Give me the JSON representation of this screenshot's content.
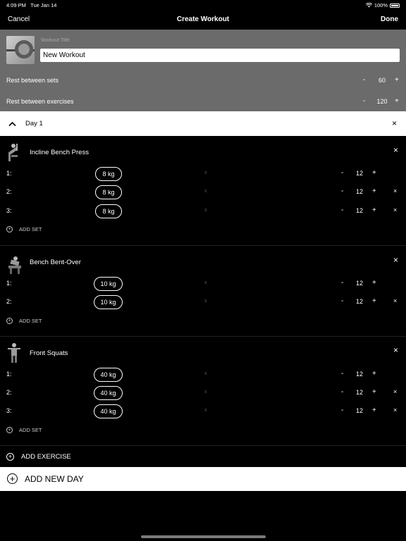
{
  "status": {
    "time": "4:09 PM",
    "date": "Tue Jan 14",
    "battery": "100%"
  },
  "nav": {
    "cancel": "Cancel",
    "title": "Create Workout",
    "done": "Done"
  },
  "header": {
    "title_label": "Workout Title",
    "title_value": "New Workout",
    "rest_sets": {
      "label": "Rest between sets",
      "minus": "-",
      "value": "60",
      "plus": "+"
    },
    "rest_exercises": {
      "label": "Rest between exercises",
      "minus": "-",
      "value": "120",
      "plus": "+"
    }
  },
  "day": {
    "chevron": "^",
    "label": "Day 1",
    "close": "×"
  },
  "exercises": [
    {
      "name": "Incline Bench Press",
      "close": "×",
      "add_set": "ADD SET",
      "sets": [
        {
          "index": "1:",
          "weight": "8 kg",
          "mult": "x",
          "minus": "-",
          "reps": "12",
          "plus": "+",
          "delete": ""
        },
        {
          "index": "2:",
          "weight": "8 kg",
          "mult": "x",
          "minus": "-",
          "reps": "12",
          "plus": "+",
          "delete": "×"
        },
        {
          "index": "3:",
          "weight": "8 kg",
          "mult": "x",
          "minus": "-",
          "reps": "12",
          "plus": "+",
          "delete": "×"
        }
      ]
    },
    {
      "name": "Bench Bent-Over",
      "close": "×",
      "add_set": "ADD SET",
      "sets": [
        {
          "index": "1:",
          "weight": "10 kg",
          "mult": "x",
          "minus": "-",
          "reps": "12",
          "plus": "+",
          "delete": ""
        },
        {
          "index": "2:",
          "weight": "10 kg",
          "mult": "x",
          "minus": "-",
          "reps": "12",
          "plus": "+",
          "delete": "×"
        }
      ]
    },
    {
      "name": "Front Squats",
      "close": "×",
      "add_set": "ADD SET",
      "sets": [
        {
          "index": "1:",
          "weight": "40 kg",
          "mult": "x",
          "minus": "-",
          "reps": "12",
          "plus": "+",
          "delete": ""
        },
        {
          "index": "2:",
          "weight": "40 kg",
          "mult": "x",
          "minus": "-",
          "reps": "12",
          "plus": "+",
          "delete": "×"
        },
        {
          "index": "3:",
          "weight": "40 kg",
          "mult": "x",
          "minus": "-",
          "reps": "12",
          "plus": "+",
          "delete": "×"
        }
      ]
    }
  ],
  "add_exercise": "ADD EXERCISE",
  "add_new_day": "ADD NEW DAY",
  "icons": {
    "wifi": "wifi-icon",
    "battery": "battery-icon",
    "plus_circle": "plus-circle-icon",
    "close": "close-icon",
    "chevron_up": "chevron-up-icon"
  }
}
